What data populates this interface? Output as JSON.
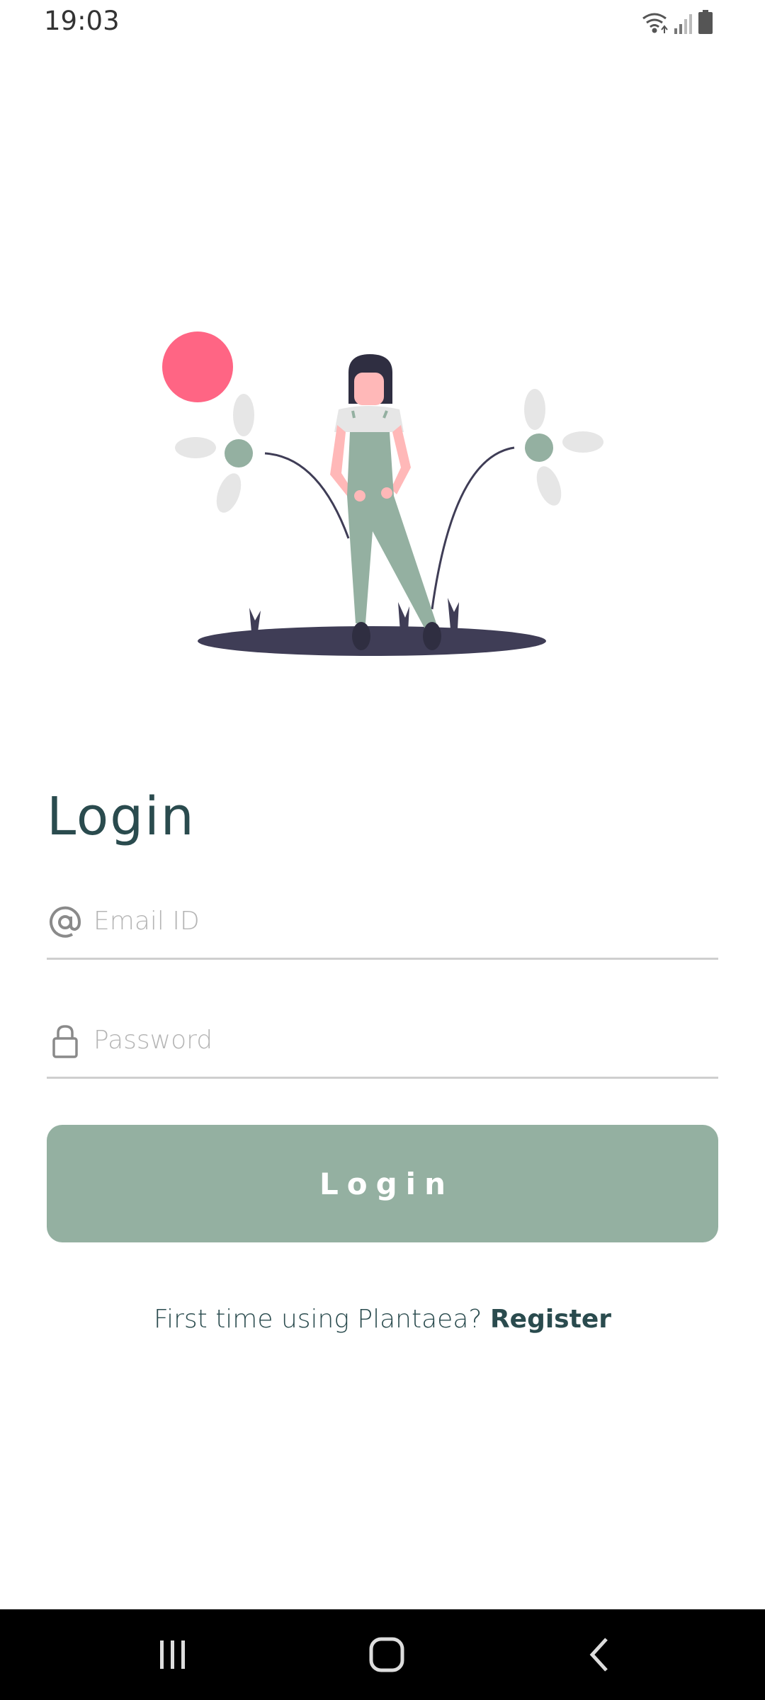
{
  "status_bar": {
    "time": "19:03",
    "icons": [
      "wifi-icon",
      "signal-icon",
      "battery-icon"
    ]
  },
  "illustration": {
    "description_icon": "woman-with-flowers-illustration",
    "colors": {
      "sun": "#ff6584",
      "overalls": "#94b0a1",
      "ground": "#3f3d56",
      "petals": "#e6e6e6",
      "skin": "#ffb8b8"
    }
  },
  "login": {
    "title": "Login",
    "email_placeholder": "Email ID",
    "email_value": "",
    "password_placeholder": "Password",
    "password_value": "",
    "button_label": "Login"
  },
  "register": {
    "prompt": "First time using Plantaea?",
    "link": "Register"
  },
  "colors": {
    "accent": "#94b0a1",
    "text_dark": "#2a4b4e",
    "divider": "#cfcfcf"
  },
  "nav_bar": {
    "buttons": [
      "recents-icon",
      "home-icon",
      "back-icon"
    ]
  }
}
